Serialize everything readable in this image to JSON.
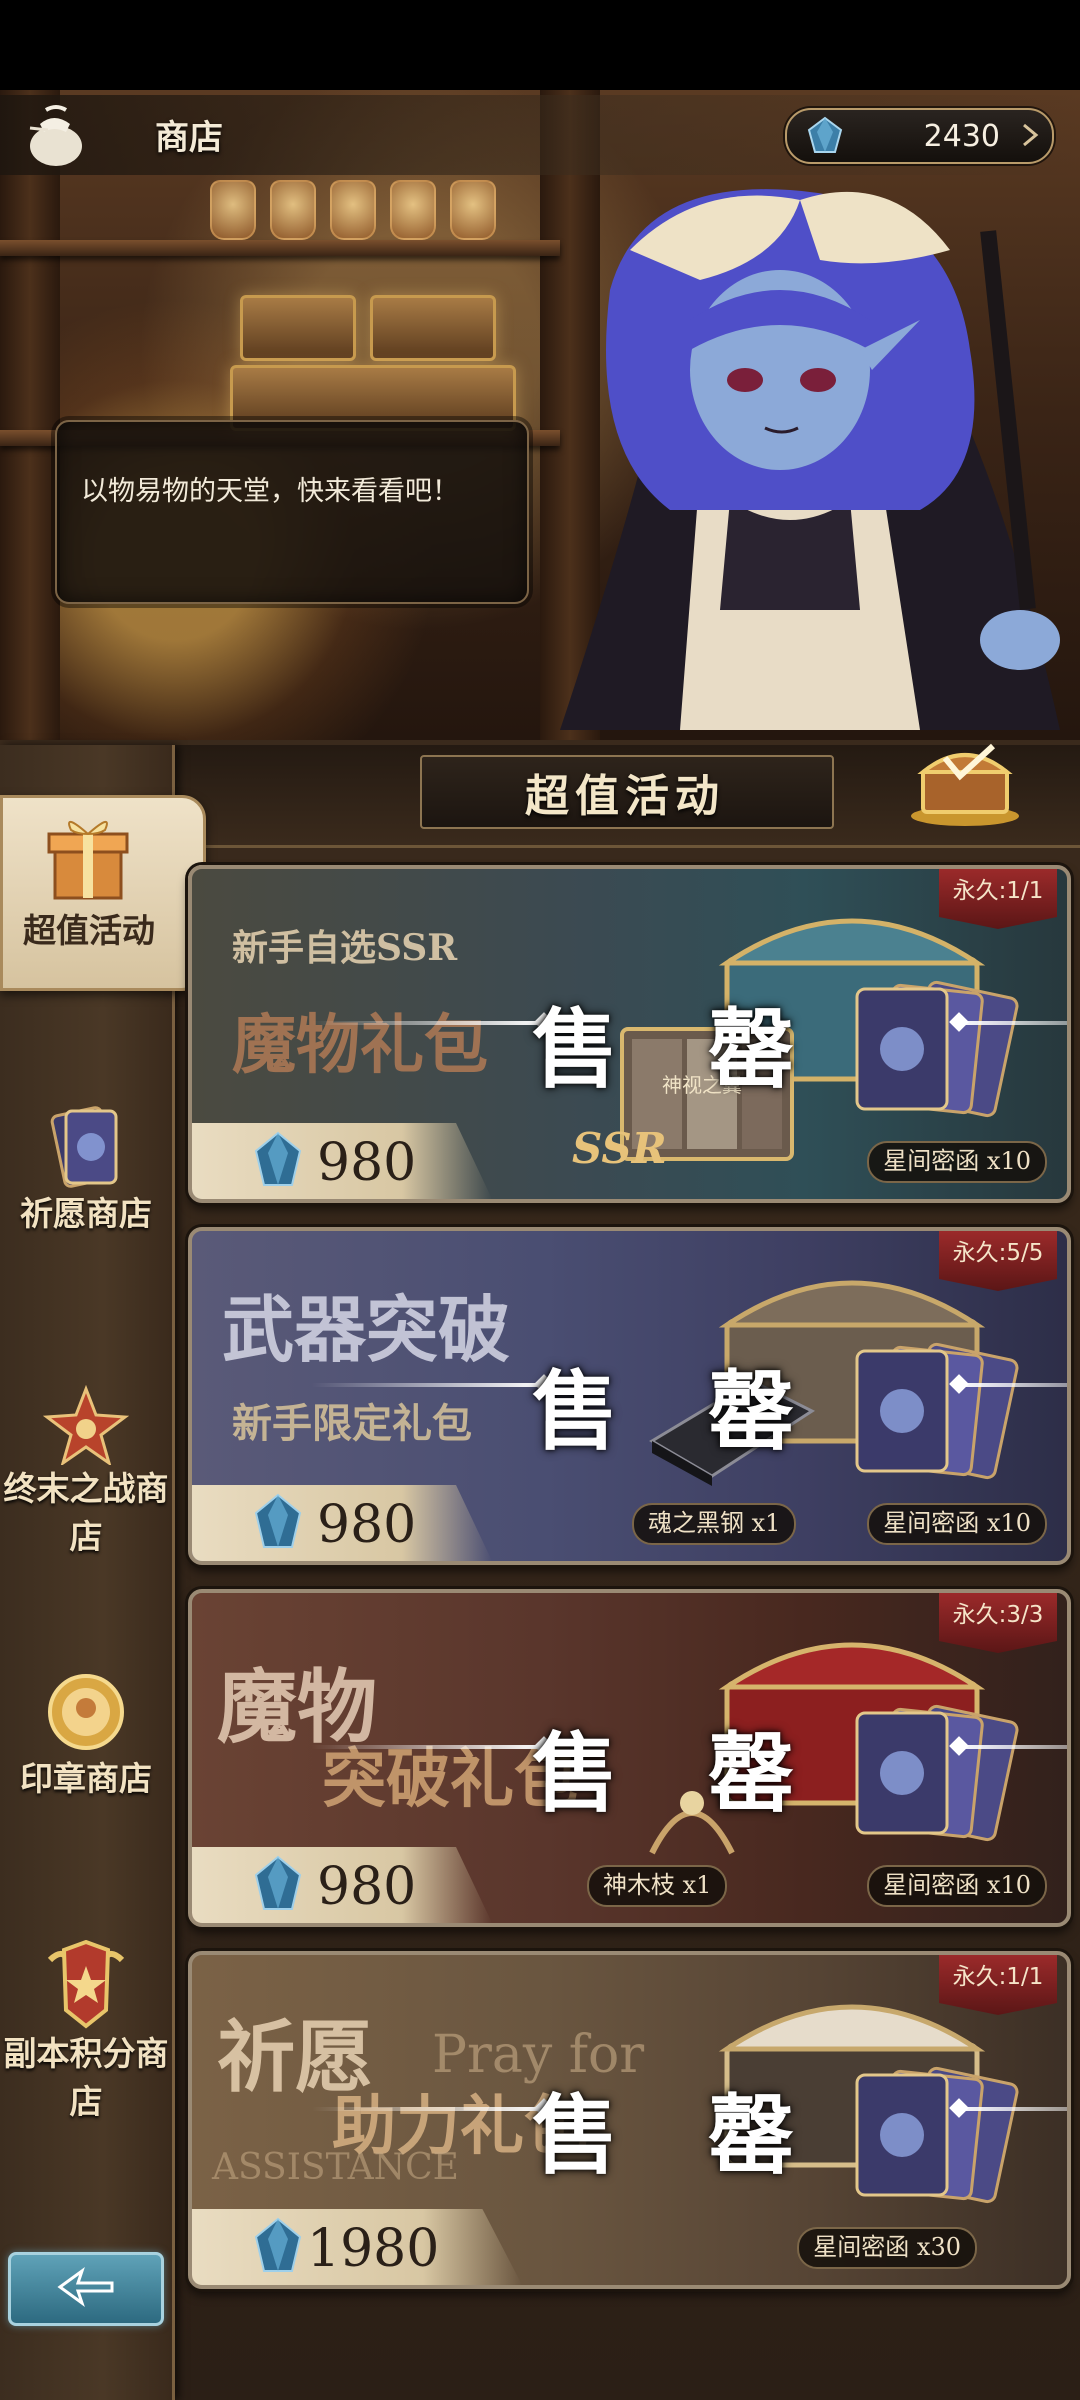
{
  "header": {
    "title": "商店",
    "currency_amount": "2430"
  },
  "hero": {
    "speech": "以物易物的天堂，快来看看吧！"
  },
  "sidebar": {
    "items": [
      {
        "label": "超值活动",
        "active": true
      },
      {
        "label": "祈愿商店"
      },
      {
        "label": "终末之战商店"
      },
      {
        "label": "印章商店"
      },
      {
        "label": "副本积分商店"
      }
    ]
  },
  "section": {
    "title": "超值活动"
  },
  "cards": [
    {
      "title_line1": "新手自选SSR",
      "title_line2": "魔物礼包",
      "limit": "永久:1/1",
      "sold_out": "售 罄",
      "price": "980",
      "items": [
        "星间密函 x10"
      ],
      "badge": "SSR",
      "sub_badge": "神视之翼"
    },
    {
      "title_line1": "武器突破",
      "title_line2": "新手限定礼包",
      "limit": "永久:5/5",
      "sold_out": "售 罄",
      "price": "980",
      "items": [
        "魂之黑钢 x1",
        "星间密函 x10"
      ]
    },
    {
      "title_line1": "魔物",
      "title_line2": "突破礼包",
      "limit": "永久:3/3",
      "sold_out": "售 罄",
      "price": "980",
      "items": [
        "神木枝 x1",
        "星间密函 x10"
      ]
    },
    {
      "title_line1": "祈愿",
      "title_line2": "助力礼包",
      "title_en1": "Pray for",
      "title_en2": "ASSISTANCE",
      "limit": "永久:1/1",
      "sold_out": "售 罄",
      "price": "1980",
      "items": [
        "星间密函 x30"
      ]
    }
  ],
  "colors": {
    "gold": "#c9a36a",
    "limit_red": "#9b2a2a",
    "gem_blue": "#3c7fa8"
  }
}
